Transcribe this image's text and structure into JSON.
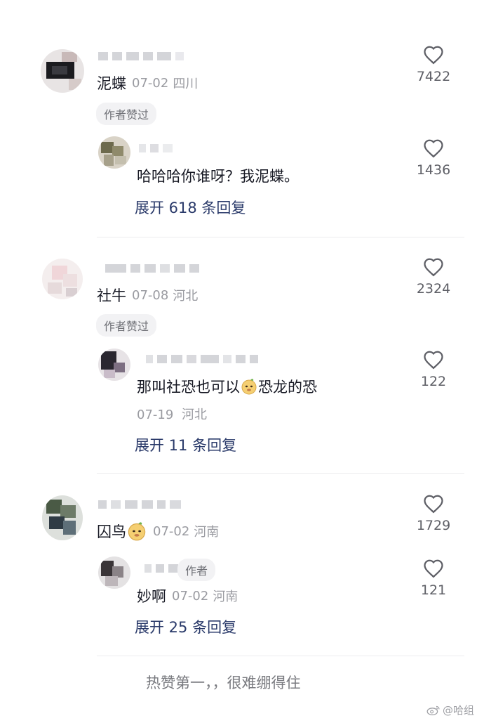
{
  "comments": [
    {
      "name": "泥蝶",
      "date": "07-02",
      "location": "四川",
      "badge": "作者赞过",
      "likes": "7422",
      "reply": {
        "text": "哈哈哈你谁呀？我泥蝶。",
        "likes": "1436"
      },
      "expand": "展开 618 条回复"
    },
    {
      "name": "社牛",
      "date": "07-08",
      "location": "河北",
      "badge": "作者赞过",
      "likes": "2324",
      "reply": {
        "text_before": "那叫社恐也可以",
        "emoji": "doge-emoji",
        "text_after": "恐龙的恐",
        "date": "07-19",
        "location": "河北",
        "likes": "122"
      },
      "expand": "展开 11 条回复"
    },
    {
      "name": "囚鸟",
      "emoji": "doge-emoji",
      "date": "07-02",
      "location": "河南",
      "likes": "1729",
      "reply": {
        "author_tag": "作者",
        "text": "妙啊",
        "date": "07-02",
        "location": "河南",
        "likes": "121"
      },
      "expand": "展开 25 条回复"
    }
  ],
  "caption": "热赞第一，，很难绷得住",
  "watermark": "@哈组",
  "colors": {
    "expand_link": "#2a3a6a",
    "meta_gray": "#9a9ba1",
    "badge_bg": "#f2f2f4"
  },
  "icons": {
    "like": "heart-outline-icon",
    "watermark": "weibo-icon"
  }
}
